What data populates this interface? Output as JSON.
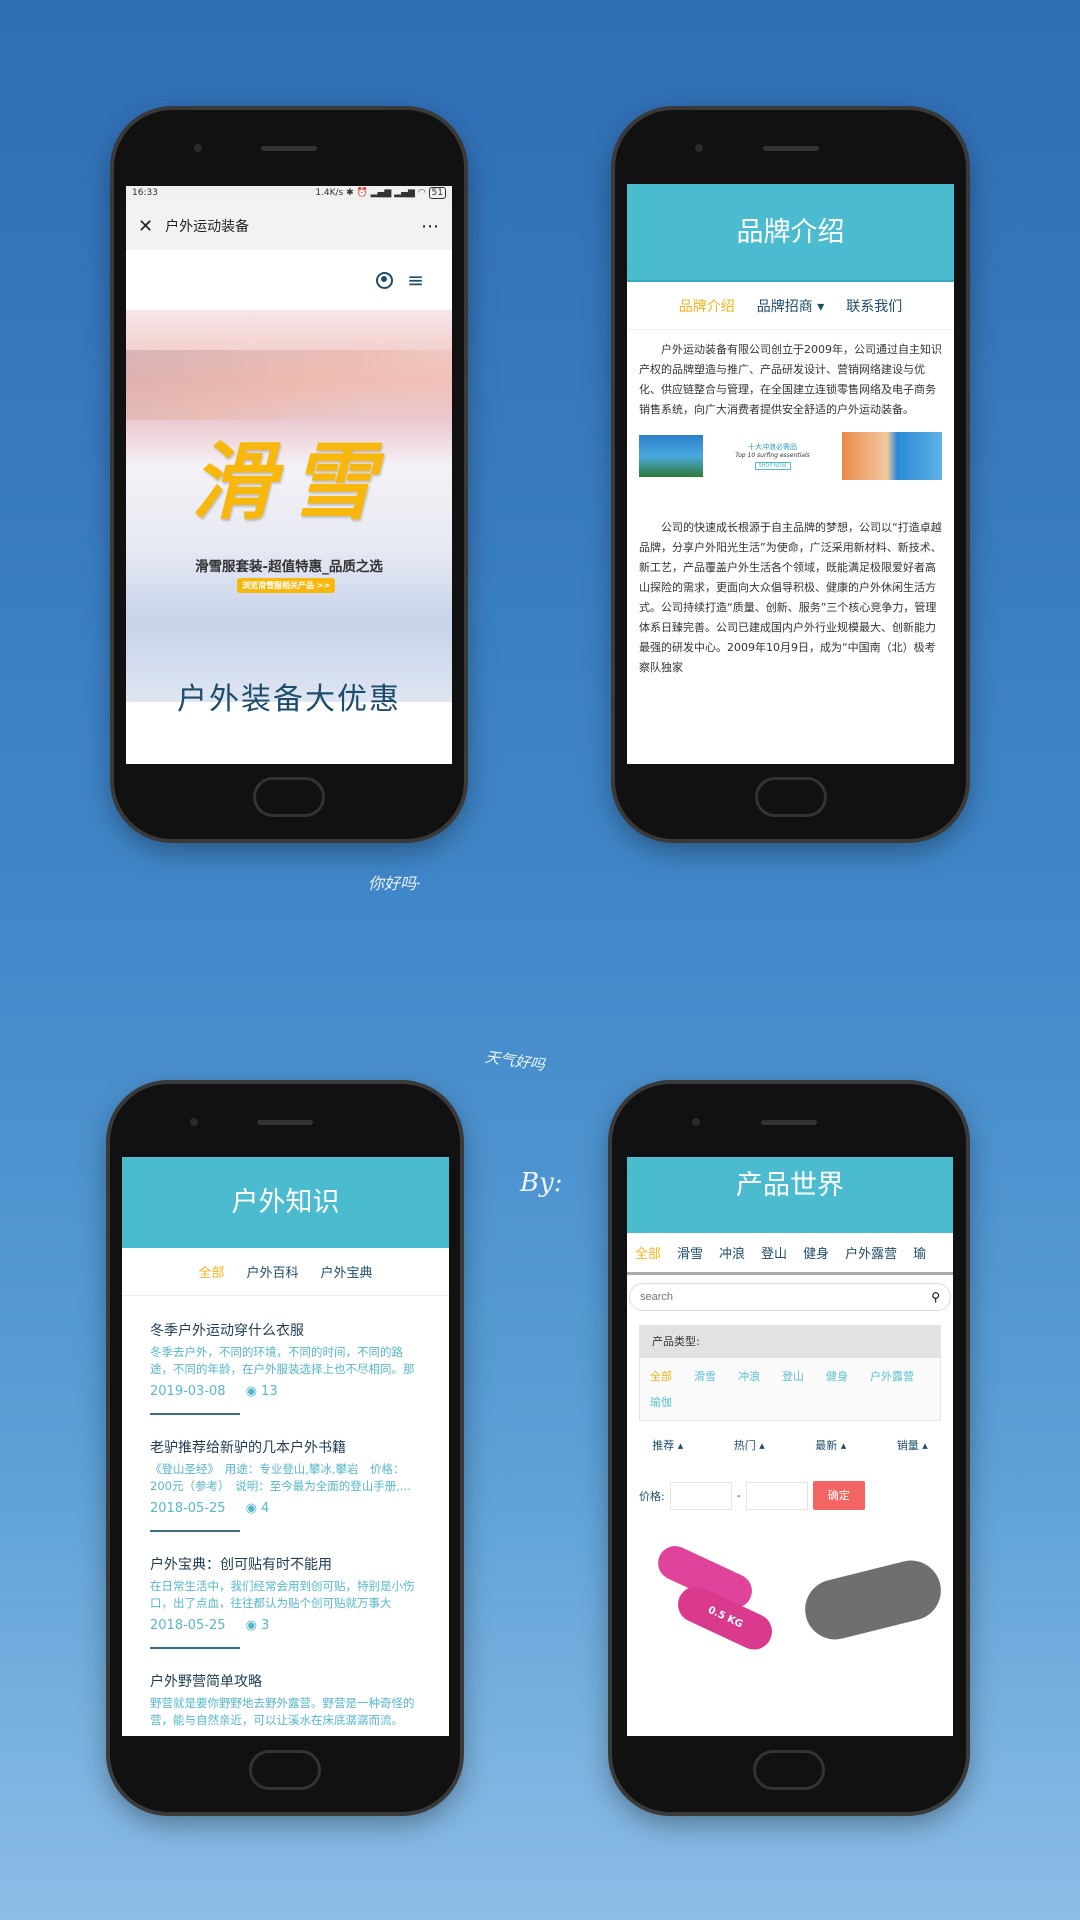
{
  "handwriting": [
    "你好吗·",
    "天气好吗",
    "By:"
  ],
  "screen1": {
    "status": {
      "time": "16:33",
      "speed": "1.4K/s",
      "battery": "51"
    },
    "titlebar": {
      "title": "户外运动装备",
      "close_icon": "close-icon",
      "more_icon": "more-icon"
    },
    "icons": {
      "user": "user-circle-icon",
      "menu": "hamburger-menu-icon"
    },
    "banner": {
      "headline": "滑雪",
      "subtitle": "滑雪服套装-超值特惠_品质之选",
      "button": "浏览滑雪服相关产品 >>"
    },
    "section_title": "户外装备大优惠"
  },
  "screen2": {
    "header": "品牌介绍",
    "nav": [
      {
        "label": "品牌介绍",
        "active": true
      },
      {
        "label": "品牌招商 ▾",
        "active": false
      },
      {
        "label": "联系我们",
        "active": false
      }
    ],
    "para1": "户外运动装备有限公司创立于2009年，公司通过自主知识产权的品牌塑造与推广、产品研发设计、营销网络建设与优化、供应链整合与管理，在全国建立连锁零售网络及电子商务销售系统，向广大消费者提供安全舒适的户外运动装备。",
    "promo": {
      "title": "十大冲浪必需品",
      "subtitle": "Top 10 surfing essentials",
      "button": "SHOP NOW"
    },
    "para2": "公司的快速成长根源于自主品牌的梦想，公司以“打造卓越品牌，分享户外阳光生活”为使命，广泛采用新材料、新技术、新工艺，产品覆盖户外生活各个领域，既能满足极限爱好者高山探险的需求，更面向大众倡导积极、健康的户外休闲生活方式。公司持续打造“质量、创新、服务”三个核心竞争力，管理体系日臻完善。公司已建成国内户外行业规模最大、创新能力最强的研发中心。2009年10月9日，成为“中国南（北）极考察队独家"
  },
  "screen3": {
    "header": "户外知识",
    "tabs": [
      {
        "label": "全部",
        "active": true
      },
      {
        "label": "户外百科",
        "active": false
      },
      {
        "label": "户外宝典",
        "active": false
      }
    ],
    "articles": [
      {
        "title": "冬季户外运动穿什么衣服",
        "excerpt": "冬季去户外，不同的环境，不同的时间，不同的路途，不同的年龄，在户外服装选择上也不尽相同。那么...",
        "date": "2019-03-08",
        "views": "13"
      },
      {
        "title": "老驴推荐给新驴的几本户外书籍",
        "excerpt": "《登山圣经》　用途：专业登山,攀冰,攀岩　价格：200元（参考）　说明：至今最为全面的登山手册,...",
        "date": "2018-05-25",
        "views": "4"
      },
      {
        "title": "户外宝典：创可贴有时不能用",
        "excerpt": "在日常生活中，我们经常会用到创可贴，特别是小伤口，出了点血，往往都认为贴个创可贴就万事大吉，...",
        "date": "2018-05-25",
        "views": "3"
      },
      {
        "title": "户外野营简单攻略",
        "excerpt": "野营就是要你野野地去野外露营。野营是一种奇怪的营，能与自然亲近，可以让溪水在床底潺潺而流。野...",
        "date": "",
        "views": ""
      }
    ]
  },
  "screen4": {
    "header": "产品世界",
    "tabs": [
      {
        "label": "全部",
        "active": true
      },
      {
        "label": "滑雪"
      },
      {
        "label": "冲浪"
      },
      {
        "label": "登山"
      },
      {
        "label": "健身"
      },
      {
        "label": "户外露营"
      },
      {
        "label": "瑜"
      }
    ],
    "search_placeholder": "search",
    "type_label": "产品类型:",
    "types": [
      {
        "label": "全部",
        "active": true
      },
      {
        "label": "滑雪"
      },
      {
        "label": "冲浪"
      },
      {
        "label": "登山"
      },
      {
        "label": "健身"
      },
      {
        "label": "户外露营"
      },
      {
        "label": "瑜伽"
      }
    ],
    "sort": [
      "推荐 ▴",
      "热门 ▴",
      "最新 ▴",
      "销量 ▴"
    ],
    "price_label": "价格:",
    "price_sep": "-",
    "confirm": "确定",
    "products": [
      {
        "label": "0.5 KG"
      },
      {
        "label": ""
      }
    ],
    "colors": {
      "teal": "#4bbbd0",
      "accent": "#f4b31e",
      "confirm": "#f26563"
    }
  }
}
